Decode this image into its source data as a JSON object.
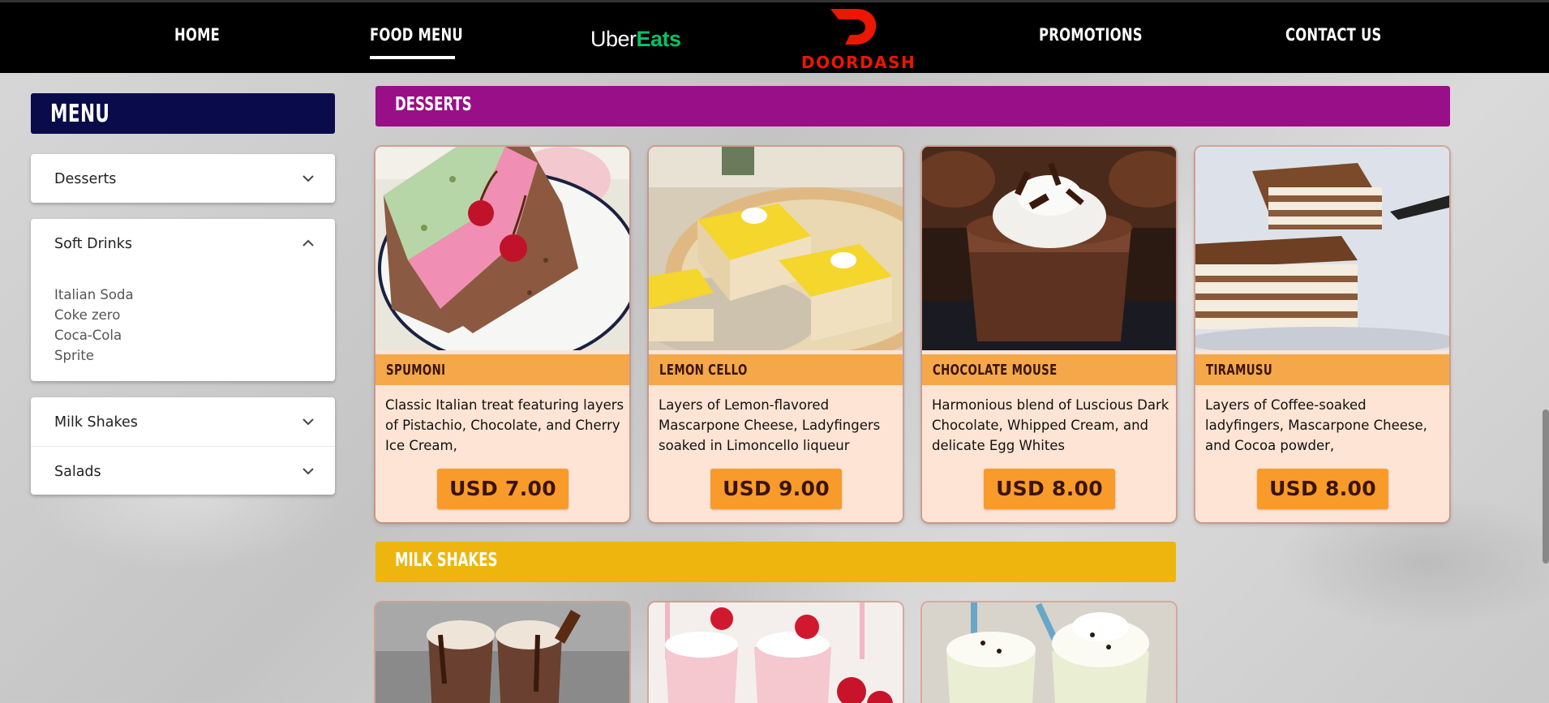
{
  "nav": {
    "home": "HOME",
    "food_menu": "FOOD MENU",
    "ubereats_uber": "Uber",
    "ubereats_eats": "Eats",
    "doordash": "DOORDASH",
    "promotions": "PROMOTIONS",
    "contact": "CONTACT US"
  },
  "sidebar": {
    "title": "MENU",
    "categories": [
      {
        "label": "Desserts",
        "expanded": false
      },
      {
        "label": "Soft Drinks",
        "expanded": true,
        "items": [
          "Italian Soda",
          "Coke zero",
          "Coca-Cola",
          "Sprite"
        ]
      },
      {
        "label": "Milk Shakes",
        "expanded": false
      },
      {
        "label": "Salads",
        "expanded": false
      }
    ]
  },
  "sections": {
    "desserts": {
      "title": "DESSERTS",
      "color": "#990f87"
    },
    "milkshakes": {
      "title": "MILK SHAKES",
      "color": "#efb50f"
    }
  },
  "desserts": [
    {
      "name": "SPUMONI",
      "desc": "Classic Italian treat featuring layers of Pistachio, Chocolate, and Cherry Ice Cream,",
      "price": "USD 7.00"
    },
    {
      "name": "LEMON CELLO",
      "desc": "Layers of Lemon-flavored Mascarpone Cheese, Ladyfingers soaked in Limoncello liqueur",
      "price": "USD 9.00"
    },
    {
      "name": "CHOCOLATE MOUSE",
      "desc": "Harmonious blend of Luscious Dark Chocolate, Whipped Cream, and delicate Egg Whites",
      "price": "USD 8.00"
    },
    {
      "name": "TIRAMUSU",
      "desc": "Layers of Coffee-soaked ladyfingers, Mascarpone Cheese, and Cocoa powder,",
      "price": "USD 8.00"
    }
  ],
  "colors": {
    "nav_bg": "#000000",
    "menu_header": "#090b4b",
    "name_bar": "#f4a84a",
    "price_button": "#f99b2a",
    "card_bg": "#fde4d4"
  }
}
